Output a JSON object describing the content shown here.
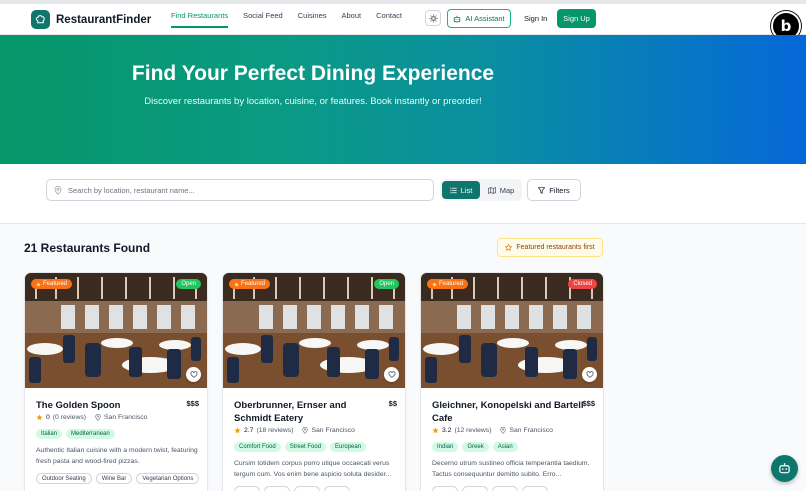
{
  "brand": {
    "name": "RestaurantFinder",
    "accent": "#059669",
    "accent_dark": "#0f766e"
  },
  "nav": {
    "items": [
      {
        "label": "Find Restaurants",
        "active": true
      },
      {
        "label": "Social Feed",
        "active": false
      },
      {
        "label": "Cuisines",
        "active": false
      },
      {
        "label": "About",
        "active": false
      },
      {
        "label": "Contact",
        "active": false
      }
    ],
    "ai_label": "AI Assistant",
    "signin_label": "Sign In",
    "signup_label": "Sign Up",
    "corner_badge": "b"
  },
  "hero": {
    "title": "Find Your Perfect Dining Experience",
    "subtitle": "Discover restaurants by location, cuisine, or features. Book instantly or preorder!"
  },
  "search": {
    "placeholder": "Search by location, restaurant name...",
    "value": "",
    "view_list_label": "List",
    "view_map_label": "Map",
    "view_selected": "List",
    "filters_label": "Filters"
  },
  "results": {
    "count_label": "21 Restaurants Found",
    "sort_note": "Featured restaurants first"
  },
  "cards": [
    {
      "name": "The Golden Spoon",
      "price": "$$$",
      "featured_label": "Featured",
      "status": "Open",
      "status_color": "#22c55e",
      "rating": "0",
      "reviews": "(0 reviews)",
      "location": "San Francisco",
      "tags": [
        "Italian",
        "Mediterranean"
      ],
      "description": "Authentic Italian cuisine with a modern twist, featuring fresh pasta and wood-fired pizzas.",
      "features": [
        "Outdoor Seating",
        "Wine Bar",
        "Vegetarian Options"
      ]
    },
    {
      "name": "Oberbrunner, Ernser and Schmidt Eatery",
      "price": "$$",
      "featured_label": "Featured",
      "status": "Open",
      "status_color": "#22c55e",
      "rating": "2.7",
      "reviews": "(18 reviews)",
      "location": "San Francisco",
      "tags": [
        "Comfort Food",
        "Street Food",
        "European"
      ],
      "description": "Cursim totidem corpus porro utique occaecati verus tergum cum. Vos enim bene aspicio soluta desider...",
      "features": [
        "",
        "",
        "",
        ""
      ]
    },
    {
      "name": "Gleichner, Konopelski and Bartell Cafe",
      "price": "$$$",
      "featured_label": "Featured",
      "status": "Closed",
      "status_color": "#ef4444",
      "rating": "3.2",
      "reviews": "(12 reviews)",
      "location": "San Francisco",
      "tags": [
        "Indian",
        "Greek",
        "Asian"
      ],
      "description": "Decerno utrum sustineo officia temperantia taedium. Tactus consequuntur demitto subito. Erro...",
      "features": [
        "",
        "",
        "",
        ""
      ]
    }
  ]
}
